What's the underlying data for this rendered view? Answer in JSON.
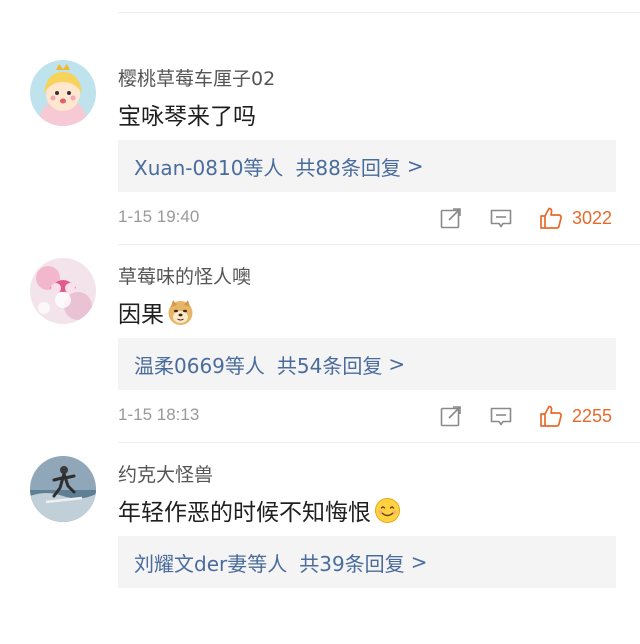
{
  "comments": [
    {
      "username": "樱桃草莓车厘子02",
      "content": "宝咏琴来了吗",
      "emoji": "",
      "reply_names": "Xuan-0810等人",
      "reply_count": "共88条回复",
      "reply_arrow": ">",
      "time": "1-15 19:40",
      "likes": "3022"
    },
    {
      "username": "草莓味的怪人噢",
      "content": "因果",
      "emoji": "doge-emoji",
      "reply_names": "温柔0669等人",
      "reply_count": "共54条回复",
      "reply_arrow": ">",
      "time": "1-15 18:13",
      "likes": "2255"
    },
    {
      "username": "约克大怪兽",
      "content": "年轻作恶的时候不知悔恨",
      "emoji": "smile-emoji",
      "reply_names": "刘耀文der妻等人",
      "reply_count": "共39条回复",
      "reply_arrow": ">",
      "time": "",
      "likes": ""
    }
  ],
  "colors": {
    "link": "#4a6c9c",
    "like": "#e86a2b",
    "meta": "#999999",
    "reply_bg": "#f4f4f4"
  },
  "icons": [
    "share-icon",
    "comment-icon",
    "thumbs-up-icon"
  ]
}
